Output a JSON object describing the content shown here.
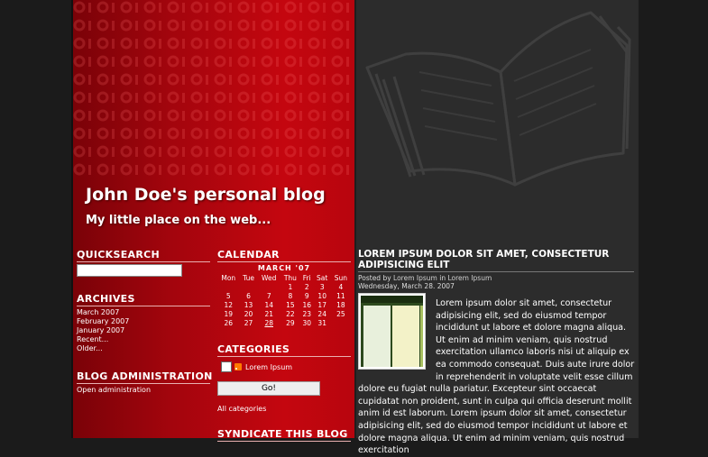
{
  "header": {
    "title": "John Doe's personal blog",
    "subtitle": "My little place on the web..."
  },
  "sidebar": {
    "quicksearch": {
      "heading": "QUICKSEARCH",
      "value": ""
    },
    "archives": {
      "heading": "ARCHIVES",
      "items": [
        "March 2007",
        "February 2007",
        "January 2007",
        "Recent...",
        "Older..."
      ]
    },
    "admin": {
      "heading": "BLOG ADMINISTRATION",
      "link": "Open administration"
    },
    "calendar": {
      "heading": "CALENDAR",
      "month": "MARCH '07",
      "weekdays": [
        "Mon",
        "Tue",
        "Wed",
        "Thu",
        "Fri",
        "Sat",
        "Sun"
      ],
      "weeks": [
        [
          "",
          "",
          "",
          "1",
          "2",
          "3",
          "4"
        ],
        [
          "5",
          "6",
          "7",
          "8",
          "9",
          "10",
          "11"
        ],
        [
          "12",
          "13",
          "14",
          "15",
          "16",
          "17",
          "18"
        ],
        [
          "19",
          "20",
          "21",
          "22",
          "23",
          "24",
          "25"
        ],
        [
          "26",
          "27",
          "28",
          "29",
          "30",
          "31",
          ""
        ]
      ]
    },
    "categories": {
      "heading": "CATEGORIES",
      "item": "Lorem Ipsum",
      "go_label": "Go!",
      "all_link": "All categories"
    },
    "syndicate": {
      "heading": "SYNDICATE THIS BLOG"
    }
  },
  "post": {
    "title": "LOREM IPSUM DOLOR SIT AMET, CONSECTETUR ADIPISICING ELIT",
    "posted_by_prefix": "Posted by ",
    "author": "Lorem Ipsum",
    "in_word": " in ",
    "category": "Lorem Ipsum",
    "date": "Wednesday, March 28. 2007",
    "body": "Lorem ipsum dolor sit amet, consectetur adipisicing elit, sed do eiusmod tempor incididunt ut labore et dolore magna aliqua. Ut enim ad minim veniam, quis nostrud exercitation ullamco laboris nisi ut aliquip ex ea commodo consequat. Duis aute irure dolor in reprehenderit in voluptate velit esse cillum dolore eu fugiat nulla pariatur. Excepteur sint occaecat cupidatat non proident, sunt in culpa qui officia deserunt mollit anim id est laborum. Lorem ipsum dolor sit amet, consectetur adipisicing elit, sed do eiusmod tempor incididunt ut labore et dolore magna aliqua. Ut enim ad minim veniam, quis nostrud exercitation"
  },
  "colors": {
    "accent_red": "#c4060f",
    "dark_panel": "#2c2c2c"
  },
  "icons": {
    "header_art": "open-book-icon",
    "feed": "rss-icon"
  }
}
